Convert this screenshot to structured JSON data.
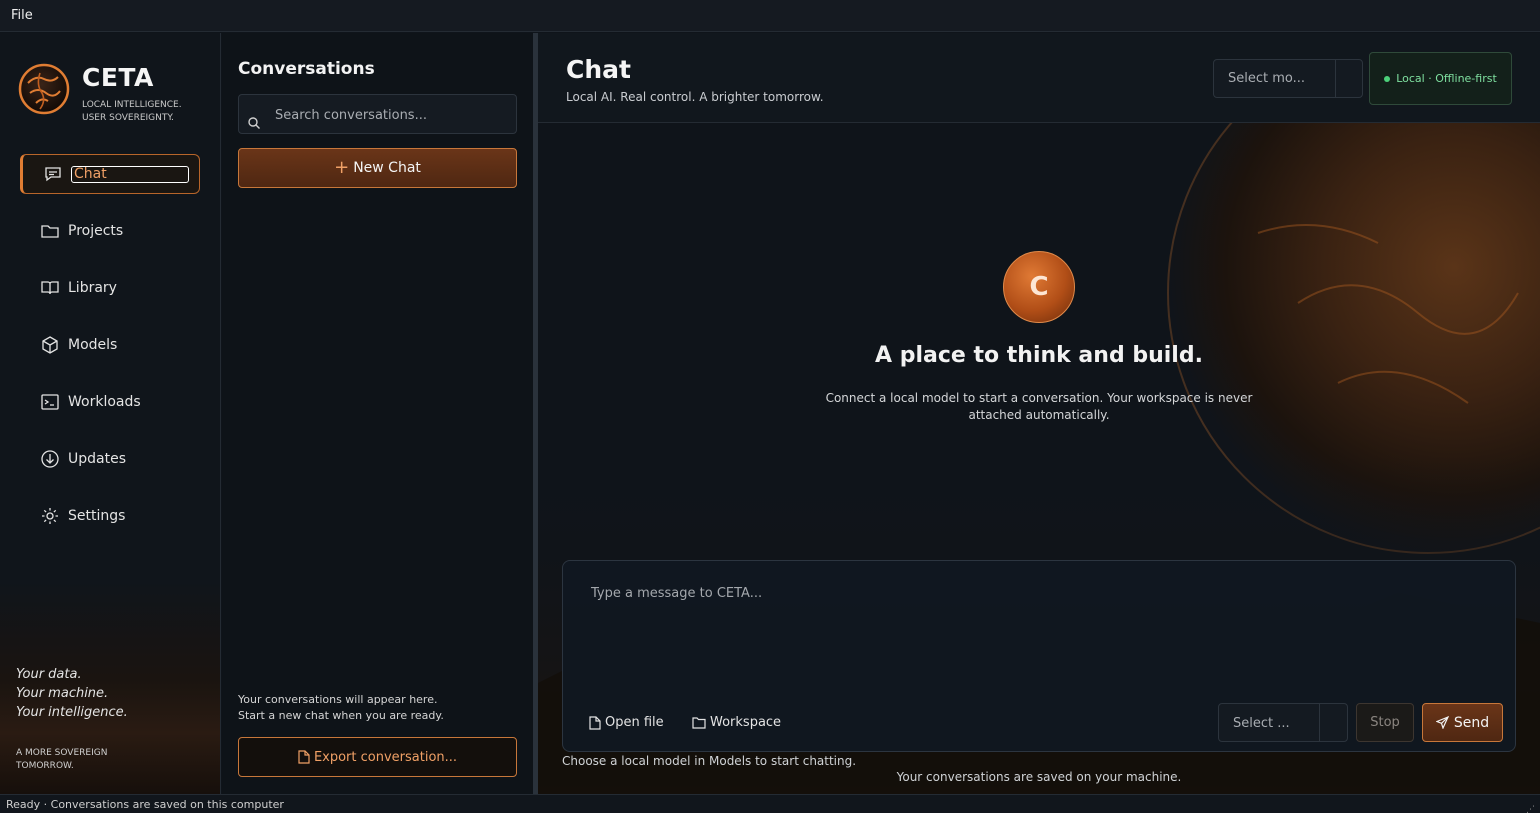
{
  "menubar": {
    "file": "File"
  },
  "brand": {
    "name": "CETA",
    "tagline_1": "LOCAL INTELLIGENCE.",
    "tagline_2": "USER SOVEREIGNTY."
  },
  "nav": {
    "items": [
      {
        "label": "Chat",
        "icon": "chat-icon",
        "active": true
      },
      {
        "label": "Projects",
        "icon": "folder-icon"
      },
      {
        "label": "Library",
        "icon": "book-icon"
      },
      {
        "label": "Models",
        "icon": "cube-icon"
      },
      {
        "label": "Workloads",
        "icon": "terminal-icon"
      },
      {
        "label": "Updates",
        "icon": "download-icon"
      },
      {
        "label": "Settings",
        "icon": "gear-icon"
      }
    ],
    "motto": {
      "line_1": "Your data.",
      "line_2": "Your machine.",
      "line_3": "Your intelligence."
    },
    "motto2": {
      "line_1": "A MORE SOVEREIGN",
      "line_2": "TOMORROW."
    }
  },
  "conversations": {
    "title": "Conversations",
    "search_placeholder": "Search conversations...",
    "new_chat": "New Chat",
    "empty_1": "Your conversations will appear here.",
    "empty_2": "Start a new chat when you are ready.",
    "export": "Export conversation..."
  },
  "main": {
    "title": "Chat",
    "subtitle": "Local AI. Real control. A brighter tomorrow.",
    "model_select": "Select mo...",
    "status_badge": "Local · Offline-first",
    "avatar_letter": "C",
    "headline": "A place to think and build.",
    "lead": "Connect a local model to start a conversation. Your workspace is never attached automatically.",
    "composer_placeholder": "Type a message to CETA...",
    "open_file": "Open file",
    "workspace": "Workspace",
    "select_small": "Select ...",
    "stop": "Stop",
    "send": "Send",
    "hint": "Choose a local model in Models to start chatting.",
    "saved": "Your conversations are saved on your machine."
  },
  "statusbar": {
    "text": "Ready · Conversations are saved on this computer"
  },
  "colors": {
    "accent": "#e07d33",
    "accent_dark": "#5a2c14",
    "online": "#4cd07a",
    "bg": "#0f141a"
  }
}
